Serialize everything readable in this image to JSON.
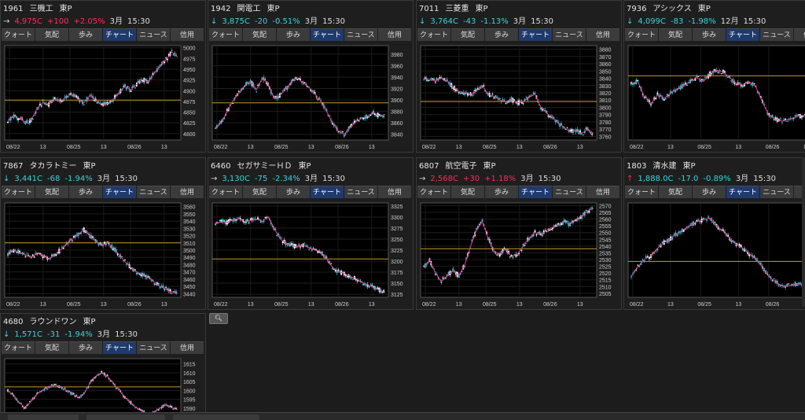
{
  "tab_labels": [
    "クォート",
    "気配",
    "歩み",
    "チャート",
    "ニュース",
    "信用"
  ],
  "active_tab": "チャート",
  "colors": {
    "down": "#3cd2dc",
    "up": "#ff2d55",
    "ma": "#e1409b",
    "ref_line": "#c89a2a",
    "candle_up": "#ffffff",
    "candle_down": "#3cd2dc"
  },
  "panels": [
    {
      "code": "1961",
      "name": "三機工",
      "market": "東P",
      "arrow": "→",
      "price": "4,975C",
      "change": "+100",
      "pct": "+2.05%",
      "dir": "up",
      "month": "3月",
      "time": "15:30",
      "chart_data": {
        "type": "line",
        "x_ticks": [
          "08/22",
          "13",
          "08/25",
          "13",
          "08/26",
          "13"
        ],
        "y_ticks": [
          4800,
          4825,
          4850,
          4875,
          4900,
          4925,
          4950,
          4975,
          5000
        ],
        "ylim": [
          4785,
          5005
        ],
        "ref": 4878,
        "series": [
          4830,
          4840,
          4835,
          4826,
          4832,
          4858,
          4872,
          4868,
          4880,
          4876,
          4884,
          4892,
          4880,
          4872,
          4888,
          4878,
          4866,
          4870,
          4880,
          4895,
          4910,
          4902,
          4915,
          4926,
          4920,
          4940,
          4958,
          4972,
          4990,
          4978
        ]
      }
    },
    {
      "code": "1942",
      "name": "関電工",
      "market": "東P",
      "arrow": "↓",
      "price": "3,875C",
      "change": "-20",
      "pct": "-0.51%",
      "dir": "down",
      "month": "3月",
      "time": "15:30",
      "chart_data": {
        "type": "line",
        "x_ticks": [
          "08/22",
          "13",
          "08/25",
          "13",
          "08/26",
          "13"
        ],
        "y_ticks": [
          3840,
          3860,
          3880,
          3900,
          3920,
          3940,
          3960,
          3980
        ],
        "ylim": [
          3830,
          3995
        ],
        "ref": 3895,
        "series": [
          3852,
          3860,
          3880,
          3898,
          3912,
          3925,
          3932,
          3918,
          3938,
          3928,
          3902,
          3908,
          3918,
          3932,
          3938,
          3930,
          3922,
          3910,
          3898,
          3880,
          3860,
          3846,
          3840,
          3852,
          3862,
          3868,
          3872,
          3878,
          3872,
          3875
        ]
      }
    },
    {
      "code": "7011",
      "name": "三菱重",
      "market": "東P",
      "arrow": "↓",
      "price": "3,764C",
      "change": "-43",
      "pct": "-1.13%",
      "dir": "down",
      "month": "3月",
      "time": "15:30",
      "chart_data": {
        "type": "line",
        "x_ticks": [
          "08/22",
          "13",
          "08/25",
          "13",
          "08/26",
          "13"
        ],
        "y_ticks": [
          3760,
          3770,
          3780,
          3790,
          3800,
          3810,
          3820,
          3830,
          3840,
          3850,
          3860,
          3870,
          3880
        ],
        "ylim": [
          3755,
          3885
        ],
        "ref": 3808,
        "series": [
          3840,
          3838,
          3836,
          3840,
          3836,
          3828,
          3822,
          3820,
          3818,
          3822,
          3830,
          3818,
          3815,
          3810,
          3808,
          3811,
          3806,
          3808,
          3814,
          3818,
          3800,
          3792,
          3786,
          3778,
          3772,
          3766,
          3768,
          3764,
          3770,
          3764
        ]
      }
    },
    {
      "code": "7936",
      "name": "アシックス",
      "market": "東P",
      "arrow": "↓",
      "price": "4,099C",
      "change": "-83",
      "pct": "-1.98%",
      "dir": "down",
      "month": "12月",
      "time": "15:30",
      "chart_data": {
        "type": "line",
        "x_ticks": [
          "08/22",
          "13",
          "08/25",
          "13",
          "08/26",
          "13"
        ],
        "y_ticks": [],
        "ylim": [
          0,
          100
        ],
        "ref": 68,
        "series": [
          60,
          62,
          46,
          38,
          48,
          44,
          50,
          54,
          58,
          62,
          66,
          62,
          70,
          74,
          72,
          66,
          60,
          58,
          62,
          56,
          40,
          26,
          22,
          20,
          22,
          24,
          26,
          26,
          24,
          25
        ]
      }
    },
    {
      "code": "7867",
      "name": "タカラトミー",
      "market": "東P",
      "arrow": "↓",
      "price": "3,441C",
      "change": "-68",
      "pct": "-1.94%",
      "dir": "down",
      "month": "3月",
      "time": "15:30",
      "chart_data": {
        "type": "line",
        "x_ticks": [
          "08/22",
          "13",
          "08/25",
          "13",
          "08/26",
          "13"
        ],
        "y_ticks": [
          3440,
          3450,
          3460,
          3470,
          3480,
          3490,
          3500,
          3510,
          3520,
          3530,
          3540,
          3550,
          3560
        ],
        "ylim": [
          3435,
          3565
        ],
        "ref": 3510,
        "series": [
          3495,
          3500,
          3497,
          3493,
          3490,
          3496,
          3492,
          3488,
          3494,
          3500,
          3508,
          3515,
          3522,
          3528,
          3520,
          3512,
          3506,
          3510,
          3502,
          3494,
          3484,
          3476,
          3470,
          3466,
          3462,
          3456,
          3450,
          3446,
          3442,
          3441
        ]
      }
    },
    {
      "code": "6460",
      "name": "セガサミーＨＤ",
      "market": "東P",
      "arrow": "→",
      "price": "3,130C",
      "change": "-75",
      "pct": "-2.34%",
      "dir": "down",
      "month": "3月",
      "time": "15:30",
      "chart_data": {
        "type": "line",
        "x_ticks": [
          "08/22",
          "13",
          "08/25",
          "13",
          "08/26",
          "13"
        ],
        "y_ticks": [
          3125,
          3150,
          3175,
          3200,
          3225,
          3250,
          3275,
          3300,
          3325
        ],
        "ylim": [
          3118,
          3332
        ],
        "ref": 3205,
        "series": [
          3285,
          3290,
          3288,
          3294,
          3296,
          3290,
          3292,
          3295,
          3290,
          3300,
          3275,
          3252,
          3240,
          3236,
          3232,
          3236,
          3230,
          3225,
          3222,
          3205,
          3186,
          3176,
          3172,
          3166,
          3160,
          3152,
          3146,
          3140,
          3134,
          3130
        ]
      }
    },
    {
      "code": "6807",
      "name": "航空電子",
      "market": "東P",
      "arrow": "→",
      "price": "2,568C",
      "change": "+30",
      "pct": "+1.18%",
      "dir": "up",
      "month": "3月",
      "time": "15:30",
      "chart_data": {
        "type": "line",
        "x_ticks": [
          "08/22",
          "13",
          "08/25",
          "13",
          "08/26",
          "13"
        ],
        "y_ticks": [
          2505,
          2510,
          2515,
          2520,
          2525,
          2530,
          2535,
          2540,
          2545,
          2550,
          2555,
          2560,
          2565,
          2570
        ],
        "ylim": [
          2502,
          2572
        ],
        "ref": 2538,
        "series": [
          2524,
          2530,
          2520,
          2514,
          2518,
          2522,
          2518,
          2526,
          2540,
          2552,
          2558,
          2546,
          2536,
          2534,
          2538,
          2532,
          2534,
          2540,
          2546,
          2550,
          2548,
          2552,
          2554,
          2556,
          2558,
          2556,
          2560,
          2562,
          2566,
          2568
        ]
      }
    },
    {
      "code": "1803",
      "name": "清水建",
      "market": "東P",
      "arrow": "↑",
      "price": "1,888.0C",
      "change": "-17.0",
      "pct": "-0.89%",
      "dir": "down",
      "month": "3月",
      "time": "15:30",
      "chart_data": {
        "type": "line",
        "x_ticks": [
          "08/22",
          "13",
          "08/25",
          "13",
          "08/26",
          "13"
        ],
        "y_ticks": [],
        "ylim": [
          0,
          100
        ],
        "ref": 38,
        "series": [
          22,
          32,
          40,
          44,
          52,
          58,
          62,
          68,
          72,
          76,
          80,
          82,
          84,
          76,
          70,
          62,
          56,
          52,
          46,
          40,
          32,
          22,
          16,
          12,
          12,
          14,
          14,
          12,
          12,
          14
        ]
      }
    },
    {
      "code": "4680",
      "name": "ラウンドワン",
      "market": "東P",
      "arrow": "↓",
      "price": "1,571C",
      "change": "-31",
      "pct": "-1.94%",
      "dir": "down",
      "month": "3月",
      "time": "15:30",
      "chart_data": {
        "type": "line",
        "x_ticks": [],
        "y_ticks": [
          1590,
          1595,
          1600,
          1605,
          1610,
          1615
        ],
        "ylim": [
          1585,
          1618
        ],
        "ref": 1602,
        "series": [
          1600,
          1597,
          1593,
          1590,
          1594,
          1598,
          1600,
          1602,
          1603,
          1602,
          1600,
          1598,
          1596,
          1598,
          1604,
          1608,
          1610,
          1608,
          1604,
          1600,
          1596,
          1593,
          1590,
          1588,
          1586,
          1588,
          1590,
          1592,
          1590,
          1589
        ]
      }
    }
  ]
}
